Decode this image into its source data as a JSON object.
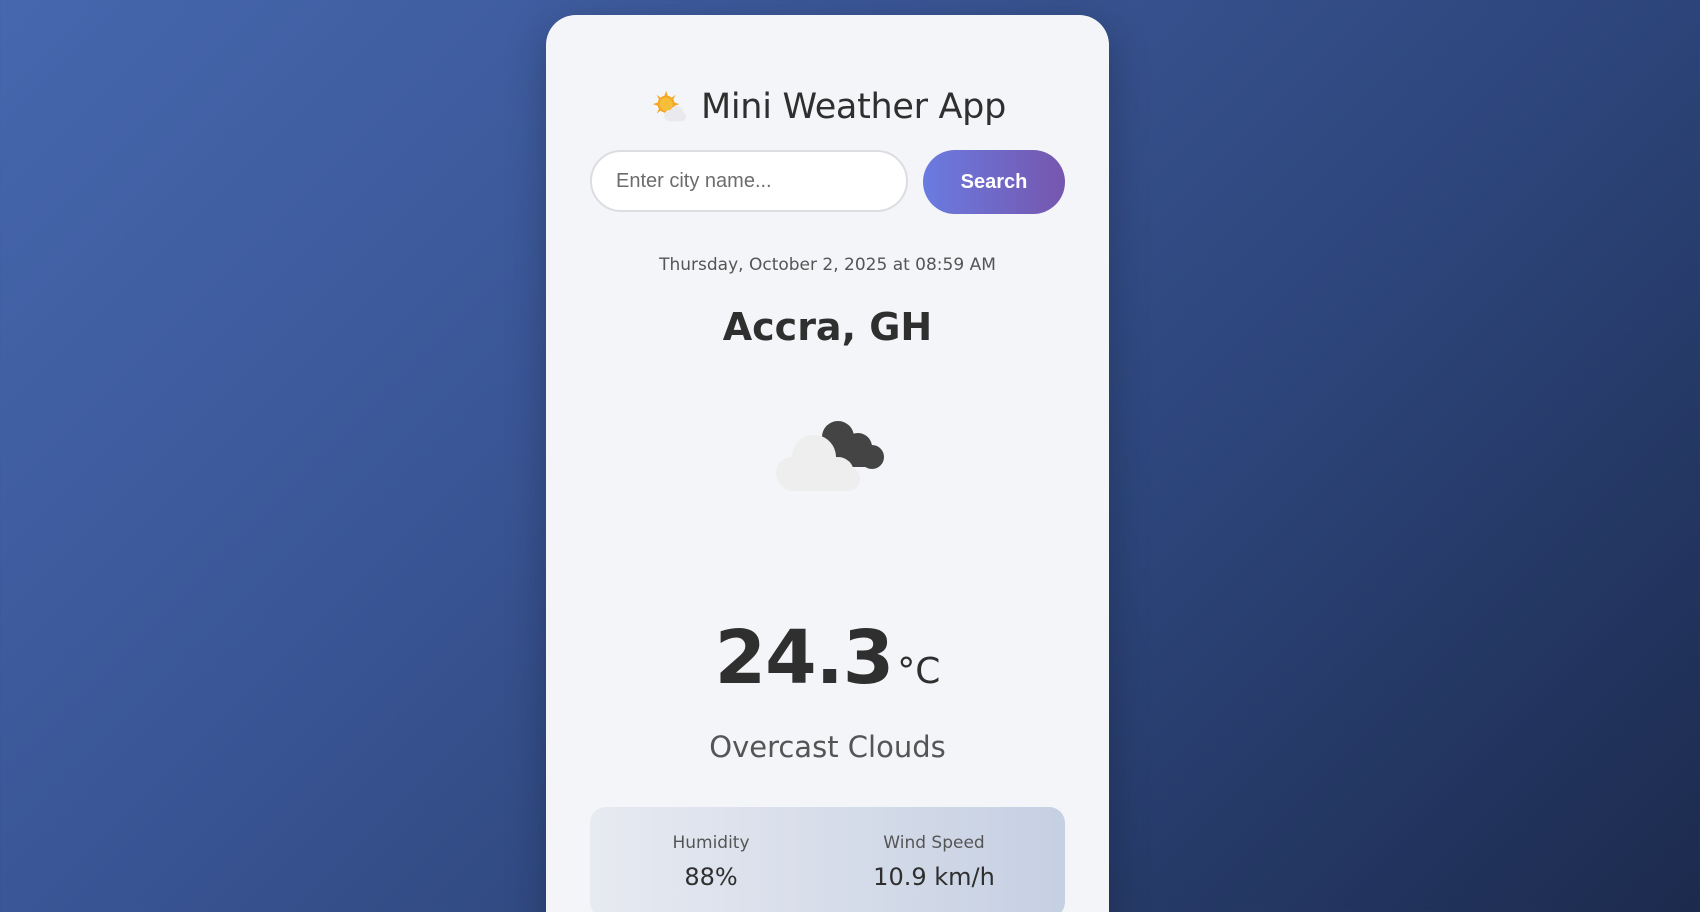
{
  "app": {
    "title": "Mini Weather App",
    "title_icon": "sun-behind-cloud-icon"
  },
  "search": {
    "placeholder": "Enter city name...",
    "value": "",
    "button_label": "Search"
  },
  "weather": {
    "datetime": "Thursday, October 2, 2025 at 08:59 AM",
    "location": "Accra, GH",
    "icon": "overcast-clouds-icon",
    "temperature": "24.3",
    "unit": "°C",
    "condition": "Overcast Clouds"
  },
  "details": {
    "humidity_label": "Humidity",
    "humidity_value": "88%",
    "wind_label": "Wind Speed",
    "wind_value": "10.9 km/h"
  },
  "colors": {
    "accent_start": "#6a7be0",
    "accent_end": "#7656ae",
    "background_start": "#4667ae",
    "background_end": "#1c2a4d"
  }
}
